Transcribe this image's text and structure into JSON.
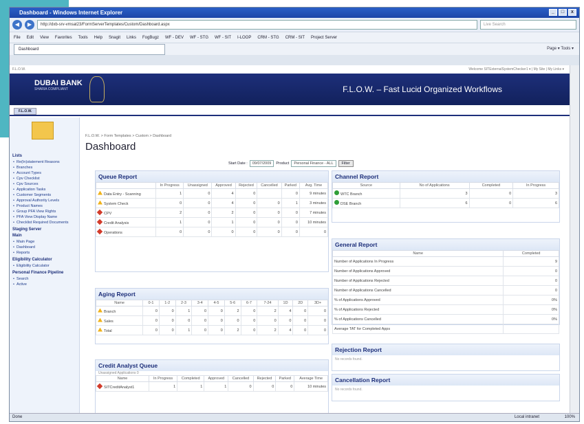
{
  "browser": {
    "title": "Dashboard - Windows Internet Explorer",
    "address": "http://dxb-srv-vmsat23/FormServerTemplates/Custom/Dashboard.aspx",
    "search_placeholder": "Live Search",
    "menu": [
      "File",
      "Edit",
      "View",
      "Favorites",
      "Tools",
      "Help"
    ],
    "snagit": "Snagit",
    "links_label": "Links",
    "links": [
      "FogBugz",
      "WF - DEV",
      "WF - STG",
      "WF - SIT",
      "I-LOOP",
      "CRM - STG",
      "CRM - SIT",
      "Project Server"
    ],
    "tab": "Dashboard",
    "tab_tools": "Page ▾  Tools ▾",
    "status_left": "Done",
    "status_zone": "Local intranet",
    "zoom": "100%"
  },
  "app": {
    "flow_label": "F.L.O.W.",
    "welcome": "Welcome SITExternalSystemChecker1 ▾ | My Site | My Links ▾",
    "bank": "DUBAI BANK",
    "bank_sub": "SHARIA COMPLIANT",
    "title": "F.L.O.W. – Fast Lucid Organized Workflows",
    "tab": "F.L.O.W.",
    "breadcrumb": "F.L.O.W. > Form Templates > Custom > Dashboard",
    "page_title": "Dashboard"
  },
  "sidebar": [
    {
      "head": "Lists",
      "items": [
        "Re(In)statement Reasons",
        "Branches",
        "Account Types",
        "Cpv Checklist",
        "Cpv Sources",
        "Application Tasks",
        "Customer Segments",
        "Approval Authority Levels",
        "Product Names",
        "Group PFA View Rights",
        "PFA View Display Name",
        "Checklist Required Documents"
      ]
    },
    {
      "head": "Staging Server",
      "items": []
    },
    {
      "head": "Main",
      "items": [
        "Main Page",
        "Dashboard",
        "Reports"
      ]
    },
    {
      "head": "Eligibility Calculator",
      "items": [
        "Eligibility Calculator"
      ]
    },
    {
      "head": "Personal Finance Pipeline",
      "items": [
        "Search",
        "Active"
      ]
    }
  ],
  "filter": {
    "start_label": "Start Date :",
    "start": "09/07/2009",
    "product_label": "Product",
    "product": "Personal Finance - ALL",
    "button": "Filter"
  },
  "queue": {
    "title": "Queue Report",
    "headers": [
      "",
      "In Progress",
      "Unassigned",
      "Approved",
      "Rejected",
      "Cancelled",
      "Parked",
      "Avg. Time"
    ],
    "rows": [
      {
        "icon": "warn",
        "name": "Data Entry - Scanning",
        "v": [
          "1",
          "0",
          "4",
          "0",
          "",
          "0",
          "9 minutes"
        ]
      },
      {
        "icon": "warn",
        "name": "System Check",
        "v": [
          "0",
          "0",
          "4",
          "0",
          "0",
          "1",
          "3 minutes"
        ]
      },
      {
        "icon": "diam",
        "name": "CPV",
        "v": [
          "2",
          "0",
          "2",
          "0",
          "0",
          "0",
          "7 minutes"
        ]
      },
      {
        "icon": "diam",
        "name": "Credit Analysis",
        "v": [
          "1",
          "0",
          "1",
          "0",
          "0",
          "0",
          "10 minutes"
        ]
      },
      {
        "icon": "diam",
        "name": "Operations",
        "v": [
          "0",
          "0",
          "0",
          "0",
          "0",
          "0",
          "0"
        ]
      }
    ]
  },
  "aging": {
    "title": "Aging Report",
    "headers": [
      "Name",
      "0-1",
      "1-2",
      "2-3",
      "3-4",
      "4-5",
      "5-6",
      "6-7",
      "7-24",
      "1D",
      "2D",
      "3D+"
    ],
    "rows": [
      {
        "name": "Branch",
        "v": [
          "0",
          "0",
          "1",
          "0",
          "0",
          "2",
          "0",
          "2",
          "4",
          "0",
          "0"
        ]
      },
      {
        "name": "Sales",
        "v": [
          "0",
          "0",
          "0",
          "0",
          "0",
          "0",
          "0",
          "0",
          "0",
          "0",
          "0"
        ]
      },
      {
        "name": "Total",
        "v": [
          "0",
          "0",
          "1",
          "0",
          "0",
          "2",
          "0",
          "2",
          "4",
          "0",
          "0"
        ]
      }
    ]
  },
  "credit": {
    "title": "Credit Analyst Queue",
    "subtitle": "Unassigned Applications 0",
    "headers": [
      "Name",
      "In Progress",
      "Completed",
      "Approved",
      "Cancelled",
      "Rejected",
      "Parked",
      "Average Time"
    ],
    "rows": [
      {
        "name": "SITCreditAnalyst1",
        "v": [
          "1",
          "1",
          "1",
          "0",
          "0",
          "0",
          "10 minutes"
        ]
      }
    ]
  },
  "channel": {
    "title": "Channel Report",
    "headers": [
      "Source",
      "No of Applications",
      "Completed",
      "In Progress"
    ],
    "rows": [
      {
        "name": "WTC Branch",
        "v": [
          "3",
          "0",
          "3"
        ]
      },
      {
        "name": "DSE Branch",
        "v": [
          "6",
          "0",
          "6"
        ]
      }
    ]
  },
  "general": {
    "title": "General Report",
    "headers": [
      "Name",
      "Completed"
    ],
    "rows": [
      {
        "name": "Number of Applications In Progress",
        "v": "9"
      },
      {
        "name": "Number of Applications Approved",
        "v": "0"
      },
      {
        "name": "Number of Applications Rejected",
        "v": "0"
      },
      {
        "name": "Number of Applications Cancelled",
        "v": "0"
      },
      {
        "name": "% of Applications Approved",
        "v": "0%"
      },
      {
        "name": "% of Applications Rejected",
        "v": "0%"
      },
      {
        "name": "% of Applications Cancelled",
        "v": "0%"
      },
      {
        "name": "Average TAT for Completed Apps",
        "v": ""
      }
    ]
  },
  "rejection": {
    "title": "Rejection Report",
    "empty": "No records found."
  },
  "cancellation": {
    "title": "Cancellation Report",
    "empty": "No records found."
  }
}
